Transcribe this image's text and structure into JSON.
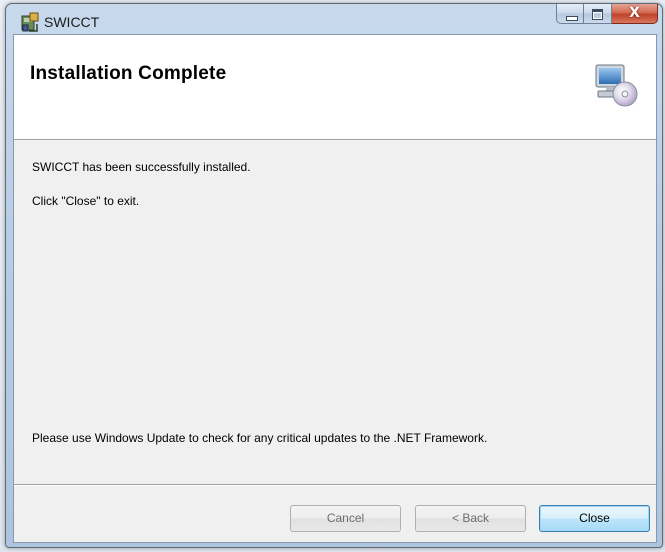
{
  "window": {
    "title": "SWICCT"
  },
  "banner": {
    "title": "Installation Complete",
    "icon": "computer-disc-icon"
  },
  "body": {
    "line1": "SWICCT has been successfully installed.",
    "line2": "Click \"Close\" to exit.",
    "line3": "Please use Windows Update to check for any critical updates to the .NET Framework."
  },
  "buttons": {
    "cancel": "Cancel",
    "back": "< Back",
    "close": "Close"
  },
  "caption_buttons": {
    "close_glyph": "X"
  },
  "colors": {
    "accent": "#3c7fb1",
    "title_bar": "#c8d9ec",
    "close_button": "#c0412a"
  }
}
